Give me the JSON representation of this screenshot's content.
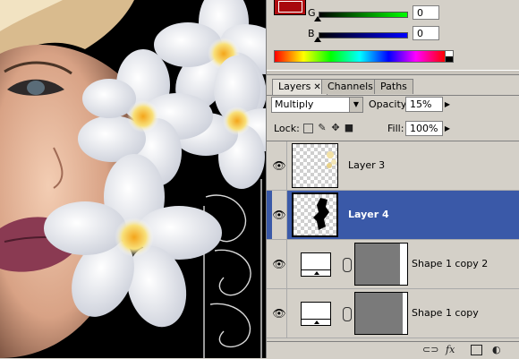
{
  "color_panel": {
    "g_label": "G",
    "g_value": "0",
    "b_label": "B",
    "b_value": "0",
    "foreground_color": "#b00d11"
  },
  "layers_panel": {
    "tabs": [
      {
        "label": "Layers",
        "close": "✕",
        "active": true
      },
      {
        "label": "Channels",
        "active": false
      },
      {
        "label": "Paths",
        "active": false
      }
    ],
    "blend_mode": "Multiply",
    "opacity_label": "Opacity:",
    "opacity_value": "15%",
    "lock_label": "Lock:",
    "fill_label": "Fill:",
    "fill_value": "100%",
    "layers": [
      {
        "name": "Layer 3",
        "selected": false
      },
      {
        "name": "Layer 4",
        "selected": true
      },
      {
        "name": "Shape 1 copy 2",
        "selected": false
      },
      {
        "name": "Shape 1 copy",
        "selected": false
      }
    ]
  },
  "footer": {
    "link_icon": "link-icon",
    "fx_label": "fx",
    "mask_icon": "mask-icon",
    "adjustment_icon": "adjustment-icon"
  },
  "colors": {
    "selection": "#3a59a8",
    "panel": "#d4d0c8"
  }
}
